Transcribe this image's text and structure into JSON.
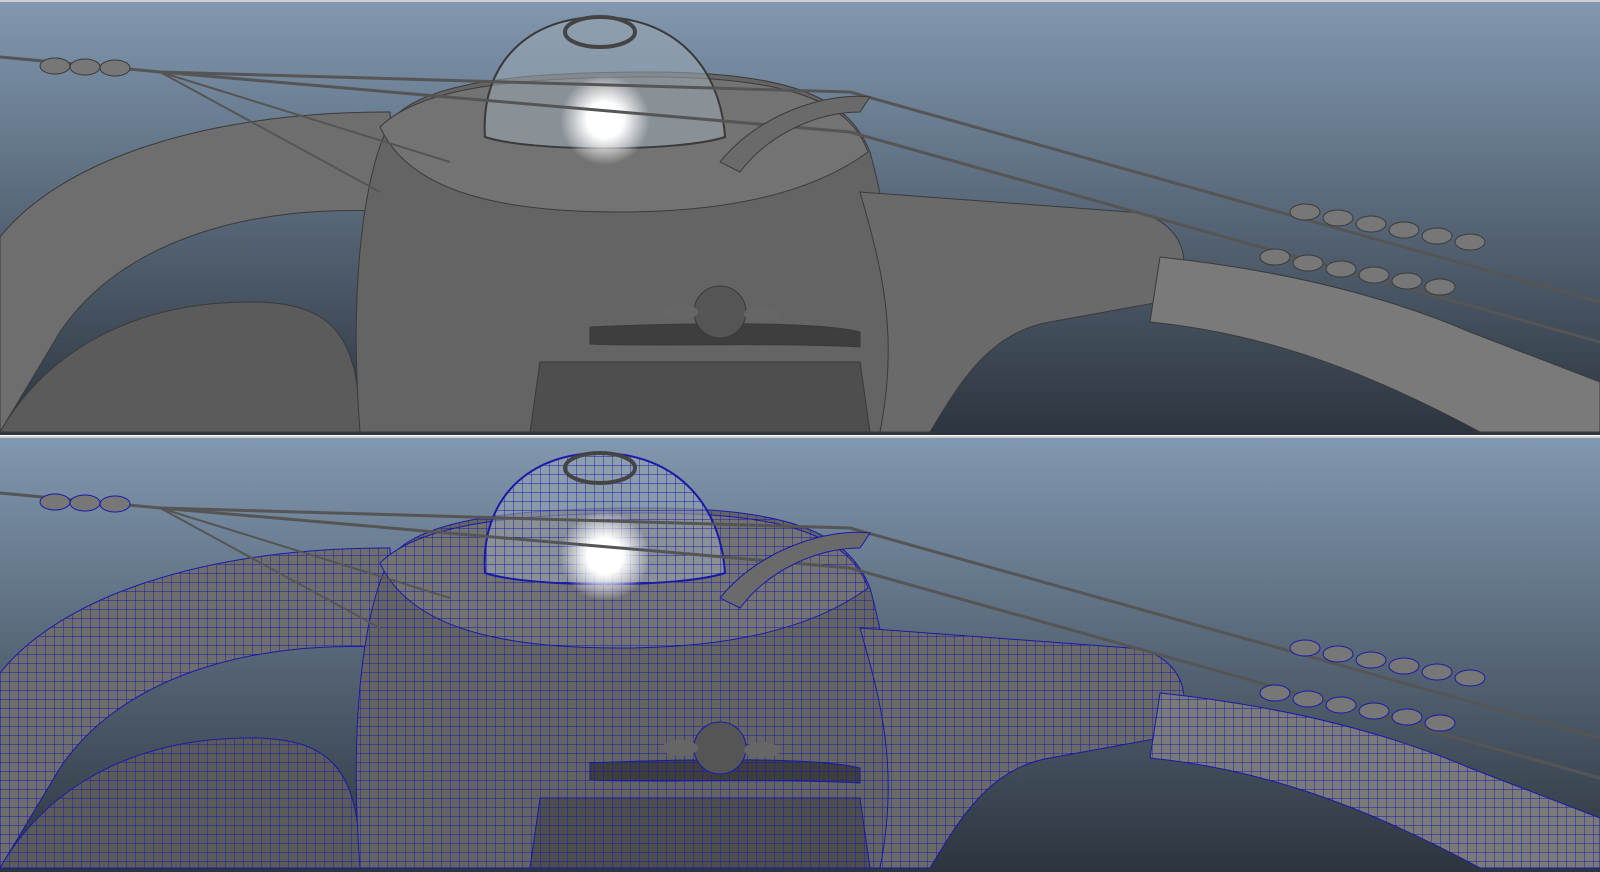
{
  "viewports": [
    {
      "id": "shaded",
      "mode": "smooth-shaded"
    },
    {
      "id": "wireframe",
      "mode": "wireframe-on-shaded"
    }
  ],
  "colors": {
    "sky_top": "#8198b0",
    "sky_bottom": "#2c343e",
    "model_gray": "#6c6c6c",
    "wireframe": "#1a1aa8"
  }
}
